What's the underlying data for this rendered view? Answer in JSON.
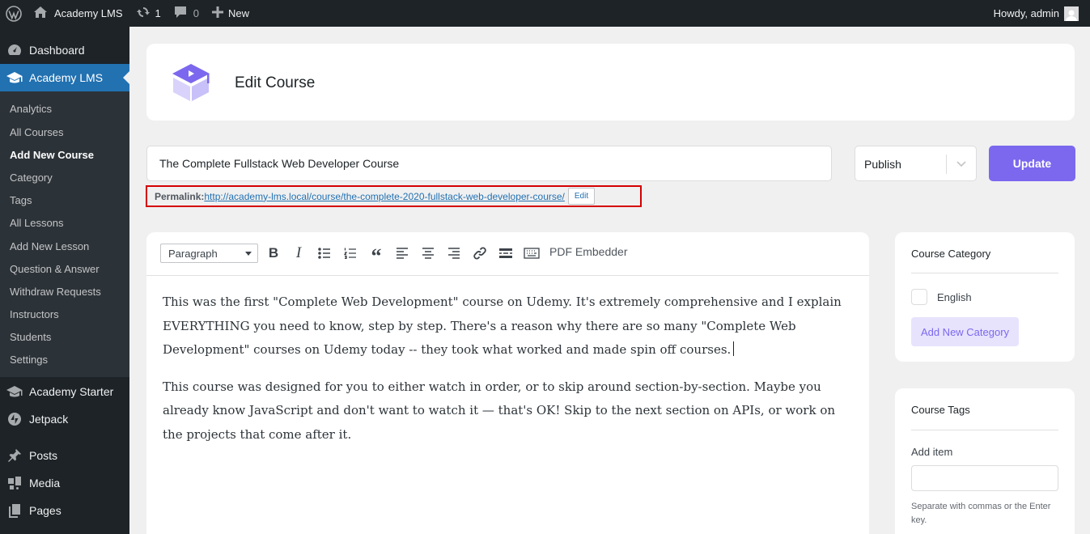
{
  "admin_bar": {
    "site_name": "Academy LMS",
    "updates_count": "1",
    "comments_count": "0",
    "new_label": "New",
    "howdy": "Howdy, admin"
  },
  "sidebar": {
    "top_items": [
      {
        "label": "Dashboard",
        "icon": "dashboard-icon"
      },
      {
        "label": "Academy LMS",
        "icon": "graduation-cap-icon",
        "current": true
      }
    ],
    "submenu": [
      {
        "label": "Analytics"
      },
      {
        "label": "All Courses"
      },
      {
        "label": "Add New Course",
        "active": true
      },
      {
        "label": "Category"
      },
      {
        "label": "Tags"
      },
      {
        "label": "All Lessons"
      },
      {
        "label": "Add New Lesson"
      },
      {
        "label": "Question & Answer"
      },
      {
        "label": "Withdraw Requests"
      },
      {
        "label": "Instructors"
      },
      {
        "label": "Students"
      },
      {
        "label": "Settings"
      }
    ],
    "bottom_items": [
      {
        "label": "Academy Starter",
        "icon": "graduation-cap-icon"
      },
      {
        "label": "Jetpack",
        "icon": "jetpack-icon"
      },
      {
        "label": "Posts",
        "icon": "pin-icon"
      },
      {
        "label": "Media",
        "icon": "media-icon"
      },
      {
        "label": "Pages",
        "icon": "pages-icon"
      }
    ]
  },
  "header": {
    "title": "Edit Course",
    "logo_icon": "academy-logo-icon"
  },
  "course": {
    "title": "The Complete Fullstack Web Developer Course",
    "status": "Publish",
    "update_label": "Update",
    "permalink_label": "Permalink:",
    "permalink_url": "http://academy-lms.local/course/the-complete-2020-fullstack-web-developer-course/",
    "permalink_edit": "Edit"
  },
  "editor": {
    "block_type": "Paragraph",
    "toolbar_icons": [
      "bold-icon",
      "italic-icon",
      "bullet-list-icon",
      "numbered-list-icon",
      "blockquote-icon",
      "align-left-icon",
      "align-center-icon",
      "align-right-icon",
      "link-icon",
      "read-more-icon",
      "keyboard-icon"
    ],
    "pdf_embedder": "PDF Embedder",
    "paragraphs": [
      "This was the first \"Complete Web Development\" course on Udemy. It's extremely comprehensive and I explain EVERYTHING you need to know, step by step. There's a reason why there are so many \"Complete Web Development\" courses on Udemy today -- they took what worked and made spin off courses.",
      "This course was designed for you to either watch in order, or to skip around section-by-section. Maybe you already know JavaScript and don't want to watch it — that's OK! Skip to the next section on APIs, or work on the projects that come after it."
    ]
  },
  "course_category": {
    "title": "Course Category",
    "options": [
      "English"
    ],
    "add_label": "Add New Category"
  },
  "course_tags": {
    "title": "Course Tags",
    "add_label": "Add item",
    "input_value": "",
    "help": "Separate with commas or the Enter key."
  },
  "colors": {
    "admin_bar": "#1d2327",
    "menu_current": "#2271b1",
    "accent": "#7b68ee",
    "permalink_highlight": "#d50000"
  }
}
